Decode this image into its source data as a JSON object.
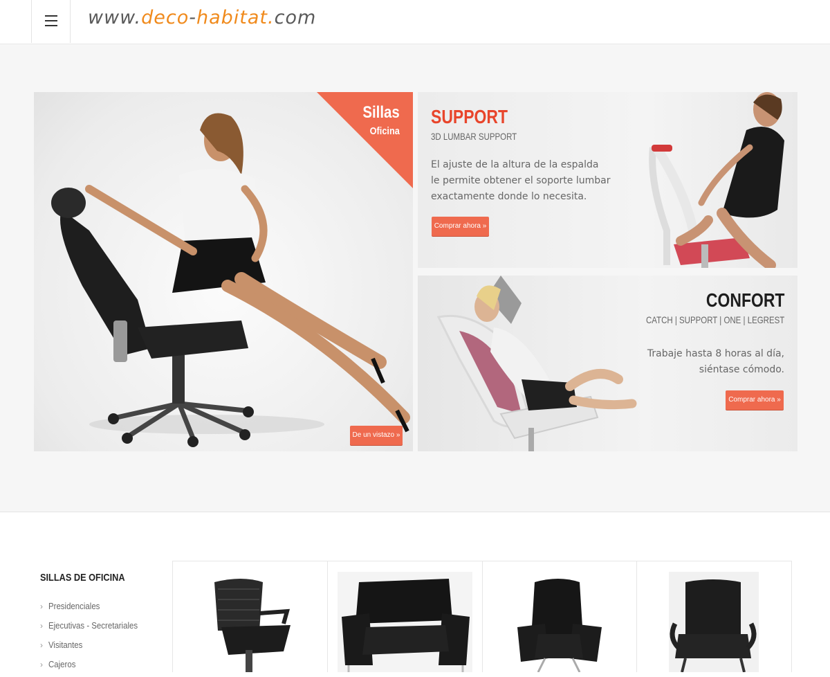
{
  "header": {
    "menu_icon": "hamburger-icon",
    "logo": {
      "prefix": "www.",
      "brand_1": "deco",
      "dash": "-",
      "brand_2": "habitat",
      "dot": ".",
      "suffix": "com"
    },
    "colors": {
      "logo_gray": "#5a5a5a",
      "logo_orange": "#f08a1c"
    }
  },
  "hero": {
    "main": {
      "ribbon_title": "Sillas",
      "ribbon_subtitle": "Oficina",
      "button": "De un vistazo »"
    },
    "support": {
      "title": "SUPPORT",
      "subtitle": "3D LUMBAR SUPPORT",
      "text": [
        "El ajuste de la altura de la espalda",
        "le permite obtener el soporte lumbar",
        "exactamente donde lo necesita."
      ],
      "button": "Comprar ahora »"
    },
    "confort": {
      "title": "CONFORT",
      "subtitle": "CATCH | SUPPORT | ONE | LEGREST",
      "text": [
        "Trabaje hasta 8 horas al día,",
        "siéntase cómodo."
      ],
      "button": "Comprar ahora »"
    },
    "colors": {
      "accent": "#ef6a4e",
      "support_title": "#e8452b"
    }
  },
  "sidebar": {
    "title": "SILLAS DE OFICINA",
    "items": [
      {
        "label": "Presidenciales"
      },
      {
        "label": "Ejecutivas - Secretariales"
      },
      {
        "label": "Visitantes"
      },
      {
        "label": "Cajeros"
      }
    ]
  },
  "products": [
    {
      "image": "mesh-office-chair-image"
    },
    {
      "image": "black-leather-lounge-chair-image"
    },
    {
      "image": "black-leather-executive-chair-image"
    },
    {
      "image": "black-fabric-visitor-chair-image"
    }
  ]
}
